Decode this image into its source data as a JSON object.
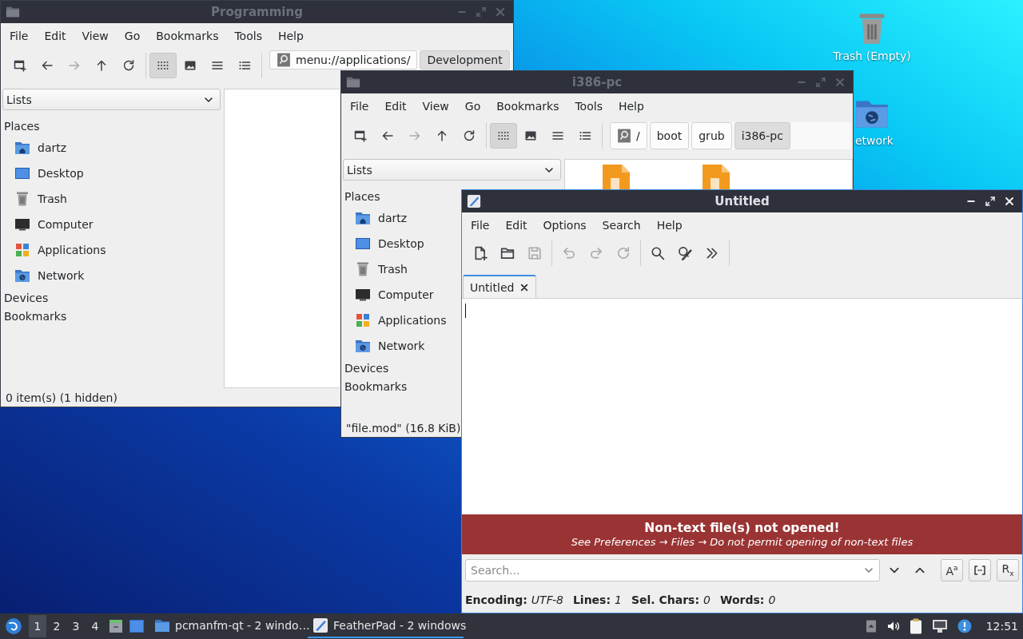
{
  "desktop": {
    "icons": [
      {
        "kind": "trash",
        "label": "Trash (Empty)"
      },
      {
        "kind": "network",
        "label": "etwork"
      }
    ]
  },
  "windows": [
    {
      "kind": "file_manager",
      "title": "Programming",
      "active": false,
      "menu": [
        "File",
        "Edit",
        "View",
        "Go",
        "Bookmarks",
        "Tools",
        "Help"
      ],
      "nav": [
        {
          "kind": "new_tab",
          "disabled": false
        },
        {
          "kind": "back",
          "disabled": false
        },
        {
          "kind": "forward",
          "disabled": true
        },
        {
          "kind": "up",
          "disabled": false
        },
        {
          "kind": "reload",
          "disabled": false
        }
      ],
      "view_modes": [
        {
          "kind": "icons",
          "selected": true
        },
        {
          "kind": "thumbnails",
          "selected": false
        },
        {
          "kind": "compact",
          "selected": false
        },
        {
          "kind": "details",
          "selected": false
        }
      ],
      "path": [
        {
          "label": "menu://applications/",
          "selected": false
        },
        {
          "label": "Development",
          "selected": true
        }
      ],
      "side_pane": {
        "mode": "Lists",
        "places_header": "Places",
        "places": [
          {
            "kind": "home",
            "label": "dartz"
          },
          {
            "kind": "desktop",
            "label": "Desktop"
          },
          {
            "kind": "trash",
            "label": "Trash"
          },
          {
            "kind": "computer",
            "label": "Computer"
          },
          {
            "kind": "applications",
            "label": "Applications"
          },
          {
            "kind": "network",
            "label": "Network"
          }
        ],
        "sections": [
          "Devices",
          "Bookmarks"
        ]
      },
      "status": "0 item(s) (1 hidden)"
    },
    {
      "kind": "file_manager",
      "title": "i386-pc",
      "active": false,
      "menu": [
        "File",
        "Edit",
        "View",
        "Go",
        "Bookmarks",
        "Tools",
        "Help"
      ],
      "nav": [
        {
          "kind": "new_tab",
          "disabled": false
        },
        {
          "kind": "back",
          "disabled": false
        },
        {
          "kind": "forward",
          "disabled": true
        },
        {
          "kind": "up",
          "disabled": false
        },
        {
          "kind": "reload",
          "disabled": false
        }
      ],
      "view_modes": [
        {
          "kind": "icons",
          "selected": true
        },
        {
          "kind": "thumbnails",
          "selected": false
        },
        {
          "kind": "compact",
          "selected": false
        },
        {
          "kind": "details",
          "selected": false
        }
      ],
      "path": [
        {
          "label": "/",
          "selected": false
        },
        {
          "label": "boot",
          "selected": false
        },
        {
          "label": "grub",
          "selected": false
        },
        {
          "label": "i386-pc",
          "selected": true
        }
      ],
      "side_pane": {
        "mode": "Lists",
        "places_header": "Places",
        "places": [
          {
            "kind": "home",
            "label": "dartz"
          },
          {
            "kind": "desktop",
            "label": "Desktop"
          },
          {
            "kind": "trash",
            "label": "Trash"
          },
          {
            "kind": "computer",
            "label": "Computer"
          },
          {
            "kind": "applications",
            "label": "Applications"
          },
          {
            "kind": "network",
            "label": "Network"
          }
        ],
        "sections": [
          "Devices",
          "Bookmarks"
        ]
      },
      "files": [
        {
          "kind": "binary"
        },
        {
          "kind": "binary"
        }
      ],
      "status": "\"file.mod\" (16.8 KiB)"
    },
    {
      "kind": "text_editor",
      "title": "Untitled",
      "active": true,
      "menu": [
        "File",
        "Edit",
        "Options",
        "Search",
        "Help"
      ],
      "toolbar": [
        {
          "kind": "new",
          "disabled": false
        },
        {
          "kind": "open",
          "disabled": false
        },
        {
          "kind": "save",
          "disabled": true
        },
        {
          "kind": "separator"
        },
        {
          "kind": "undo",
          "disabled": true
        },
        {
          "kind": "redo",
          "disabled": true
        },
        {
          "kind": "reload",
          "disabled": true
        },
        {
          "kind": "separator"
        },
        {
          "kind": "find",
          "disabled": false
        },
        {
          "kind": "replace",
          "disabled": false
        },
        {
          "kind": "more",
          "disabled": false
        },
        {
          "kind": "separator"
        }
      ],
      "tabs": [
        {
          "label": "Untitled",
          "selected": true
        }
      ],
      "warning": {
        "title": "Non-text file(s) not opened!",
        "detail": "See Preferences → Files → Do not permit opening of non-text files"
      },
      "search": {
        "placeholder": "Search..."
      },
      "search_options": [
        {
          "kind": "match_case",
          "label": "A$^{a}$"
        },
        {
          "kind": "whole_word"
        },
        {
          "kind": "regex",
          "label": "R$_{x}$"
        }
      ],
      "status": [
        {
          "label": "Encoding:",
          "value": "UTF-8"
        },
        {
          "label": "Lines:",
          "value": "1"
        },
        {
          "label": "Sel. Chars:",
          "value": "0"
        },
        {
          "label": "Words:",
          "value": "0"
        }
      ]
    }
  ],
  "taskbar": {
    "desktops": [
      {
        "label": "1",
        "selected": true
      },
      {
        "label": "2",
        "selected": false
      },
      {
        "label": "3",
        "selected": false
      },
      {
        "label": "4",
        "selected": false
      }
    ],
    "launchers": [
      {
        "kind": "file_manager"
      },
      {
        "kind": "show_desktop"
      }
    ],
    "tasks": [
      {
        "kind": "folder",
        "label": "pcmanfm-qt - 2 windo…",
        "selected": false
      },
      {
        "kind": "feather",
        "label": "FeatherPad - 2 windows",
        "selected": true
      }
    ],
    "tray": [
      {
        "kind": "hidden_icons"
      },
      {
        "kind": "volume"
      },
      {
        "kind": "clipboard"
      },
      {
        "kind": "network"
      },
      {
        "kind": "notification"
      }
    ],
    "clock": "12:51"
  }
}
